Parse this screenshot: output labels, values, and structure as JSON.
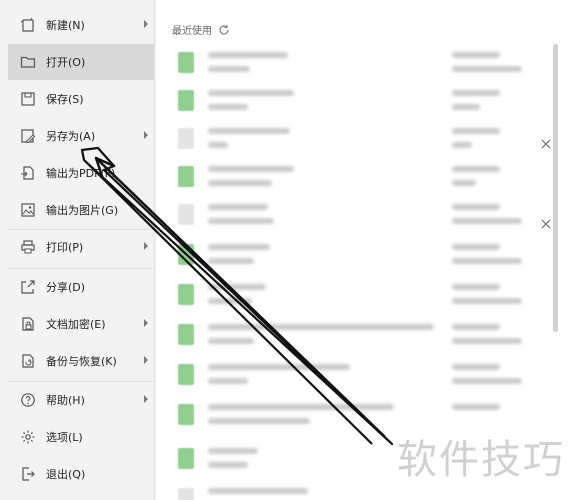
{
  "menu": {
    "items": [
      {
        "label": "新建(N)",
        "icon": "new-file-icon",
        "submenu": true
      },
      {
        "label": "打开(O)",
        "icon": "folder-icon",
        "submenu": false,
        "active": true
      },
      {
        "label": "保存(S)",
        "icon": "save-icon",
        "submenu": false
      },
      {
        "label": "另存为(A)",
        "icon": "save-as-icon",
        "submenu": true
      },
      {
        "label": "输出为PDF(F)",
        "icon": "export-pdf-icon",
        "submenu": false
      },
      {
        "label": "输出为图片(G)",
        "icon": "image-icon",
        "submenu": false
      },
      {
        "label": "打印(P)",
        "icon": "printer-icon",
        "submenu": true
      },
      {
        "label": "分享(D)",
        "icon": "share-icon",
        "submenu": false
      },
      {
        "label": "文档加密(E)",
        "icon": "lock-document-icon",
        "submenu": true
      },
      {
        "label": "备份与恢复(K)",
        "icon": "backup-icon",
        "submenu": true
      },
      {
        "label": "帮助(H)",
        "icon": "help-icon",
        "submenu": true
      },
      {
        "label": "选项(L)",
        "icon": "gear-icon",
        "submenu": false
      },
      {
        "label": "退出(Q)",
        "icon": "exit-icon",
        "submenu": false
      }
    ]
  },
  "recent": {
    "header": "最近使用",
    "refresh_icon": "refresh-icon"
  },
  "watermark": {
    "text": "软件技巧"
  },
  "colors": {
    "menu_bg": "#f3f3f3",
    "active_bg": "#d9d9d9",
    "excel_green": "#3aa03a",
    "annotation_arrow": "#111111"
  }
}
